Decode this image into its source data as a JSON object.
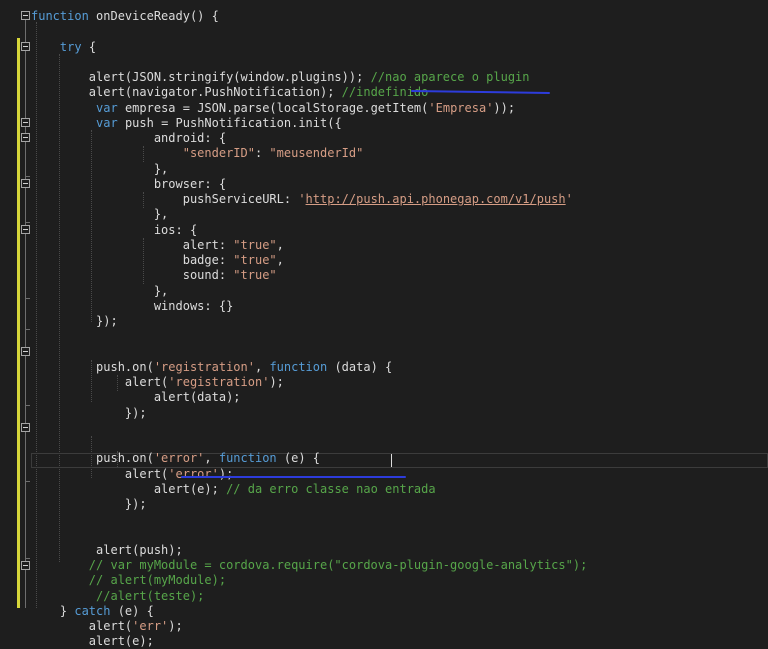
{
  "editor": {
    "lines": [
      {
        "segments": [
          {
            "t": "function",
            "c": "kw"
          },
          {
            "t": " onDeviceReady() {",
            "c": ""
          }
        ]
      },
      {
        "segments": []
      },
      {
        "segments": [
          {
            "t": "    ",
            "c": ""
          },
          {
            "t": "try",
            "c": "kw"
          },
          {
            "t": " {",
            "c": ""
          }
        ]
      },
      {
        "segments": []
      },
      {
        "segments": [
          {
            "t": "        alert(JSON.stringify(window.plugins)); ",
            "c": ""
          },
          {
            "t": "//nao aparece o plugin",
            "c": "cmt"
          }
        ]
      },
      {
        "segments": [
          {
            "t": "        alert(navigator.PushNotification); ",
            "c": ""
          },
          {
            "t": "//indefinido",
            "c": "cmt"
          }
        ]
      },
      {
        "segments": [
          {
            "t": "         ",
            "c": ""
          },
          {
            "t": "var",
            "c": "kw"
          },
          {
            "t": " empresa = JSON.parse(localStorage.getItem(",
            "c": ""
          },
          {
            "t": "'Empresa'",
            "c": "str"
          },
          {
            "t": "));",
            "c": ""
          }
        ]
      },
      {
        "segments": [
          {
            "t": "         ",
            "c": ""
          },
          {
            "t": "var",
            "c": "kw"
          },
          {
            "t": " push = PushNotification.init({",
            "c": ""
          }
        ]
      },
      {
        "segments": [
          {
            "t": "                 android: {",
            "c": ""
          }
        ]
      },
      {
        "segments": [
          {
            "t": "                     ",
            "c": ""
          },
          {
            "t": "\"senderID\"",
            "c": "str"
          },
          {
            "t": ": ",
            "c": ""
          },
          {
            "t": "\"meusenderId\"",
            "c": "str"
          }
        ]
      },
      {
        "segments": [
          {
            "t": "                 },",
            "c": ""
          }
        ]
      },
      {
        "segments": [
          {
            "t": "                 browser: {",
            "c": ""
          }
        ]
      },
      {
        "segments": [
          {
            "t": "                     pushServiceURL: ",
            "c": ""
          },
          {
            "t": "'",
            "c": "str"
          },
          {
            "t": "http://push.api.phonegap.com/v1/push",
            "c": "str lnk"
          },
          {
            "t": "'",
            "c": "str"
          }
        ]
      },
      {
        "segments": [
          {
            "t": "                 },",
            "c": ""
          }
        ]
      },
      {
        "segments": [
          {
            "t": "                 ios: {",
            "c": ""
          }
        ]
      },
      {
        "segments": [
          {
            "t": "                     alert: ",
            "c": ""
          },
          {
            "t": "\"true\"",
            "c": "str"
          },
          {
            "t": ",",
            "c": ""
          }
        ]
      },
      {
        "segments": [
          {
            "t": "                     badge: ",
            "c": ""
          },
          {
            "t": "\"true\"",
            "c": "str"
          },
          {
            "t": ",",
            "c": ""
          }
        ]
      },
      {
        "segments": [
          {
            "t": "                     sound: ",
            "c": ""
          },
          {
            "t": "\"true\"",
            "c": "str"
          }
        ]
      },
      {
        "segments": [
          {
            "t": "                 },",
            "c": ""
          }
        ]
      },
      {
        "segments": [
          {
            "t": "                 windows: {}",
            "c": ""
          }
        ]
      },
      {
        "segments": [
          {
            "t": "         });",
            "c": ""
          }
        ]
      },
      {
        "segments": []
      },
      {
        "segments": []
      },
      {
        "segments": [
          {
            "t": "         push.on(",
            "c": ""
          },
          {
            "t": "'registration'",
            "c": "str"
          },
          {
            "t": ", ",
            "c": ""
          },
          {
            "t": "function",
            "c": "kw"
          },
          {
            "t": " (data) {",
            "c": ""
          }
        ]
      },
      {
        "segments": [
          {
            "t": "             alert(",
            "c": ""
          },
          {
            "t": "'registration'",
            "c": "str"
          },
          {
            "t": ");",
            "c": ""
          }
        ]
      },
      {
        "segments": [
          {
            "t": "                 alert(data);",
            "c": ""
          }
        ]
      },
      {
        "segments": [
          {
            "t": "             });",
            "c": ""
          }
        ]
      },
      {
        "segments": []
      },
      {
        "segments": []
      },
      {
        "segments": [
          {
            "t": "         push.on(",
            "c": ""
          },
          {
            "t": "'error'",
            "c": "str"
          },
          {
            "t": ", ",
            "c": ""
          },
          {
            "t": "function",
            "c": "kw"
          },
          {
            "t": " (e) {",
            "c": ""
          }
        ]
      },
      {
        "segments": [
          {
            "t": "             alert(",
            "c": ""
          },
          {
            "t": "'error'",
            "c": "str"
          },
          {
            "t": ");",
            "c": ""
          }
        ]
      },
      {
        "segments": [
          {
            "t": "                 alert(e); ",
            "c": ""
          },
          {
            "t": "// da erro classe nao entrada",
            "c": "cmt"
          }
        ]
      },
      {
        "segments": [
          {
            "t": "             });",
            "c": ""
          }
        ]
      },
      {
        "segments": []
      },
      {
        "segments": []
      },
      {
        "segments": [
          {
            "t": "         alert(push);",
            "c": ""
          }
        ]
      },
      {
        "segments": [
          {
            "t": "        ",
            "c": ""
          },
          {
            "t": "// var myModule = cordova.require(\"cordova-plugin-google-analytics\");",
            "c": "cmt"
          }
        ]
      },
      {
        "segments": [
          {
            "t": "        ",
            "c": ""
          },
          {
            "t": "// alert(myModule);",
            "c": "cmt"
          }
        ]
      },
      {
        "segments": [
          {
            "t": "         ",
            "c": ""
          },
          {
            "t": "//alert(teste);",
            "c": "cmt"
          }
        ]
      },
      {
        "segments": [
          {
            "t": "    } ",
            "c": ""
          },
          {
            "t": "catch",
            "c": "kw"
          },
          {
            "t": " (e) {",
            "c": ""
          }
        ]
      },
      {
        "segments": [
          {
            "t": "        alert(",
            "c": ""
          },
          {
            "t": "'err'",
            "c": "str"
          },
          {
            "t": ");",
            "c": ""
          }
        ]
      },
      {
        "segments": [
          {
            "t": "        alert(e);",
            "c": ""
          }
        ]
      }
    ]
  }
}
